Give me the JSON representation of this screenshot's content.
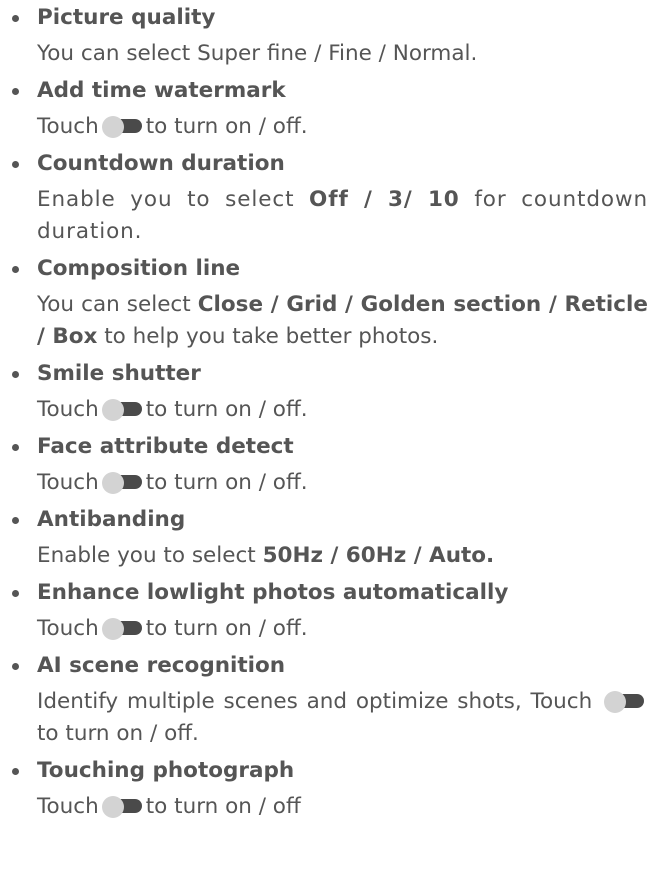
{
  "items": [
    {
      "title": "Picture quality",
      "desc": "You can select Super fine / Fine / Normal."
    },
    {
      "title": "Add time watermark",
      "pre": "Touch",
      "post": "to turn on / off."
    },
    {
      "title": "Countdown duration",
      "pre": "Enable you to select",
      "bold": "Off / 3/ 10",
      "post": "for countdown duration."
    },
    {
      "title": "Composition line",
      "pre": "You can select",
      "bold": "Close / Grid / Golden section / Reticle / Box",
      "post": "to help you take better photos."
    },
    {
      "title": "Smile shutter",
      "pre": "Touch",
      "post": "to turn on / off."
    },
    {
      "title": "Face attribute detect",
      "pre": "Touch",
      "post": "to turn on / off."
    },
    {
      "title": "Antibanding",
      "pre": "Enable you to select",
      "bold": "50Hz / 60Hz / Auto."
    },
    {
      "title": "Enhance lowlight photos automatically",
      "pre": "Touch",
      "post": "to turn on / off."
    },
    {
      "title": "AI scene recognition",
      "pre": "Identify multiple scenes and optimize shots, Touch",
      "post": "to turn on / off."
    },
    {
      "title": "Touching photograph",
      "pre": "Touch",
      "post": "to turn on / off"
    }
  ],
  "icons": {
    "toggle": "toggle-switch-icon"
  },
  "colors": {
    "text": "#555555",
    "toggle_track": "#4a4a4a",
    "toggle_knob": "#d3d3d3"
  }
}
